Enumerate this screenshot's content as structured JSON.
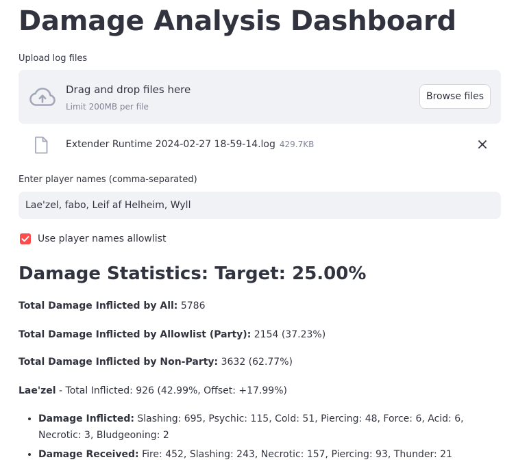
{
  "title": "Damage Analysis Dashboard",
  "upload": {
    "label": "Upload log files",
    "drop_title": "Drag and drop files here",
    "limit": "Limit 200MB per file",
    "browse_label": "Browse files",
    "file_name": "Extender Runtime 2024-02-27 18-59-14.log",
    "file_size": "429.7KB"
  },
  "players": {
    "label": "Enter player names (comma-separated)",
    "value": "Lae'zel, fabo, Leif af Helheim, Wyll"
  },
  "allowlist": {
    "label": "Use player names allowlist",
    "checked": true,
    "color": "#ff4b4b"
  },
  "stats": {
    "heading": "Damage Statistics: Target: 25.00%",
    "total_all_label": "Total Damage Inflicted by All:",
    "total_all_value": "5786",
    "total_party_label": "Total Damage Inflicted by Allowlist (Party):",
    "total_party_value": "2154 (37.23%)",
    "total_nonparty_label": "Total Damage Inflicted by Non-Party:",
    "total_nonparty_value": "3632 (62.77%)"
  },
  "player": {
    "name": "Lae'zel",
    "summary": "- Total Inflicted: 926 (42.99%, Offset: +17.99%)",
    "inflicted_label": "Damage Inflicted:",
    "inflicted_value": "Slashing: 695, Psychic: 115, Cold: 51, Piercing: 48, Force: 6, Acid: 6, Necrotic: 3, Bludgeoning: 2",
    "received_label": "Damage Received:",
    "received_value": "Fire: 452, Slashing: 243, Necrotic: 157, Piercing: 93, Thunder: 21"
  }
}
